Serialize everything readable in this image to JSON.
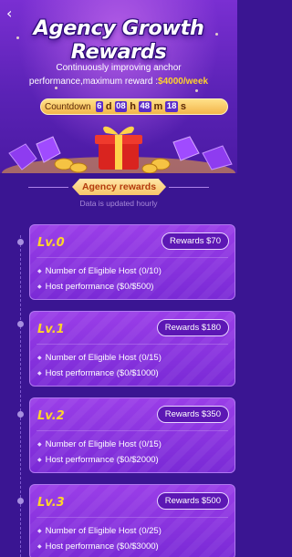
{
  "header": {
    "back_icon": "chevron-left-icon",
    "title": "Agency Growth Rewards",
    "desc_line1": "Continuously improving anchor",
    "desc_line2_prefix": "performance,maximum reward :",
    "desc_line2_amount": "$4000/week",
    "countdown": {
      "label": "Countdown",
      "days": "6",
      "day_unit": "d",
      "hours": "08",
      "hour_unit": "h",
      "minutes": "48",
      "minute_unit": "m",
      "seconds": "18",
      "second_unit": "s"
    }
  },
  "section": {
    "title": "Agency rewards",
    "subtitle": "Data is updated hourly"
  },
  "levels": [
    {
      "name": "Lv.0",
      "reward": "Rewards $70",
      "host_count": "Number of Eligible Host (0/10)",
      "performance": "Host performance ($0/$500)"
    },
    {
      "name": "Lv.1",
      "reward": "Rewards $180",
      "host_count": "Number of Eligible Host (0/15)",
      "performance": "Host performance ($0/$1000)"
    },
    {
      "name": "Lv.2",
      "reward": "Rewards $350",
      "host_count": "Number of Eligible Host (0/15)",
      "performance": "Host performance ($0/$2000)"
    },
    {
      "name": "Lv.3",
      "reward": "Rewards $500",
      "host_count": "Number of Eligible Host (0/25)",
      "performance": "Host performance ($0/$3000)"
    }
  ],
  "colors": {
    "background": "#3a1592",
    "card": "#8a34e0",
    "accent_gold": "#ffd22c",
    "level_label": "#ffd52a"
  }
}
